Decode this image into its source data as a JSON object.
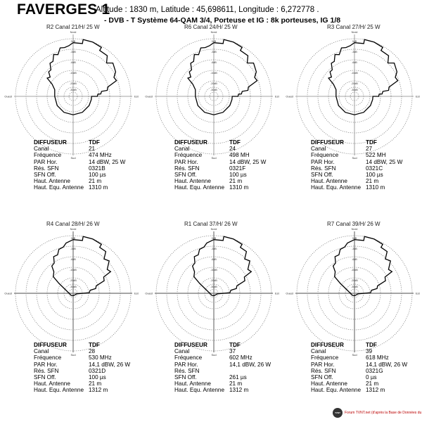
{
  "header": {
    "title": "FAVERGES 1",
    "location": "Altitude : 1830 m,  Latitude : 45,698611,  Longitude : 6,272778 .",
    "system": "- DVB - T    Système 64-QAM 3/4,  Porteuse et IG : 8k porteuses, IG 1/8"
  },
  "labels": {
    "diffuseur": "DIFFUSEUR",
    "canal": "Canal",
    "frequence": "Fréquence",
    "par": "PAR Hor.",
    "res": "Rés. SFN",
    "sfn": "SFN Off.",
    "haut": "Haut. Antenne",
    "hautequ": "Haut. Equ. Antenne"
  },
  "chart_data": [
    {
      "type": "polar",
      "title": "R2   Canal 21/H/ 25 W",
      "directions": [
        "Nord",
        "Est",
        "Sud",
        "Ouest"
      ],
      "rings": [
        "0dB",
        "-3dB",
        "-6dB",
        "-10dB",
        "-20dB",
        "-30dB"
      ],
      "pattern": "A",
      "info": {
        "diffuseur": "TDF",
        "canal": "21",
        "frequence": "474 MHz",
        "par": "14 dBW, 25 W",
        "res": "0321B",
        "sfn": "100 µs",
        "haut": "21 m",
        "hautequ": "1310 m"
      }
    },
    {
      "type": "polar",
      "title": "R6   Canal 24/H/ 25 W",
      "directions": [
        "Nord",
        "Est",
        "Sud",
        "Ouest"
      ],
      "rings": [
        "0dB",
        "-3dB",
        "-6dB",
        "-10dB",
        "-20dB",
        "-30dB"
      ],
      "pattern": "A",
      "info": {
        "diffuseur": "TDF",
        "canal": "24",
        "frequence": "498 MH",
        "par": "14 dBW, 25 W",
        "res": "0321F",
        "sfn": "100 µs",
        "haut": "21 m",
        "hautequ": "1310 m"
      }
    },
    {
      "type": "polar",
      "title": "R3   Canal 27/H/ 25 W",
      "directions": [
        "Nord",
        "Est",
        "Sud",
        "Ouest"
      ],
      "rings": [
        "0dB",
        "-3dB",
        "-6dB",
        "-10dB",
        "-20dB",
        "-30dB"
      ],
      "pattern": "A",
      "info": {
        "diffuseur": "TDF",
        "canal": "27",
        "frequence": "522 MH",
        "par": "14 dBW, 25 W",
        "res": "0321C",
        "sfn": "100 µs",
        "haut": "21 m",
        "hautequ": "1310 m"
      }
    },
    {
      "type": "polar",
      "title": "R4   Canal 28/H/ 26 W",
      "directions": [
        "Nord",
        "Est",
        "Sud",
        "Ouest"
      ],
      "rings": [
        "0dB",
        "-3dB",
        "-6dB",
        "-10dB",
        "-20dB",
        "-30dB"
      ],
      "pattern": "B",
      "info": {
        "diffuseur": "TDF",
        "canal": "28",
        "frequence": "530 MHz",
        "par": "14,1 dBW, 26 W",
        "res": "0321D",
        "sfn": "100 µs",
        "haut": "21 m",
        "hautequ": "1312 m"
      }
    },
    {
      "type": "polar",
      "title": "R1   Canal 37/H/ 26 W",
      "directions": [
        "Nord",
        "Est",
        "Sud",
        "Ouest"
      ],
      "rings": [
        "0dB",
        "-3dB",
        "-6dB",
        "-10dB",
        "-20dB",
        "-30dB"
      ],
      "pattern": "B",
      "info": {
        "diffuseur": "TDF",
        "canal": "37",
        "frequence": "602 MHz",
        "par": "14,1 dBW, 26 W",
        "res": "",
        "sfn": "261 µs",
        "haut": "21 m",
        "hautequ": "1312 m"
      }
    },
    {
      "type": "polar",
      "title": "R7   Canal 39/H/ 26 W",
      "directions": [
        "Nord",
        "Est",
        "Sud",
        "Ouest"
      ],
      "rings": [
        "0dB",
        "-3dB",
        "-6dB",
        "-10dB",
        "-20dB",
        "-30dB"
      ],
      "pattern": "B",
      "info": {
        "diffuseur": "TDF",
        "canal": "39",
        "frequence": "618 MHz",
        "par": "14,1 dBW, 26 W",
        "res": "0321G",
        "sfn": "0 µs",
        "haut": "21 m",
        "hautequ": "1312 m"
      }
    }
  ],
  "patterns": {
    "A": [
      [
        0,
        0.93
      ],
      [
        10,
        0.93
      ],
      [
        10,
        1.0
      ],
      [
        20,
        1.0
      ],
      [
        30,
        0.98
      ],
      [
        30,
        0.92
      ],
      [
        40,
        0.92
      ],
      [
        45,
        0.82
      ],
      [
        50,
        0.9
      ],
      [
        60,
        0.85
      ],
      [
        65,
        0.78
      ],
      [
        70,
        0.8
      ],
      [
        75,
        0.62
      ],
      [
        80,
        0.6
      ],
      [
        80,
        0.5
      ],
      [
        85,
        0.48
      ],
      [
        85,
        0.43
      ],
      [
        90,
        0.42
      ],
      [
        90,
        0.32
      ],
      [
        100,
        0.32
      ],
      [
        120,
        0.32
      ],
      [
        150,
        0.32
      ],
      [
        180,
        0.32
      ],
      [
        210,
        0.32
      ],
      [
        240,
        0.32
      ],
      [
        270,
        0.32
      ],
      [
        290,
        0.34
      ],
      [
        300,
        0.42
      ],
      [
        305,
        0.55
      ],
      [
        310,
        0.52
      ],
      [
        315,
        0.6
      ],
      [
        320,
        0.6
      ],
      [
        325,
        0.7
      ],
      [
        330,
        0.7
      ],
      [
        335,
        0.8
      ],
      [
        340,
        0.77
      ],
      [
        345,
        0.87
      ],
      [
        350,
        0.86
      ],
      [
        355,
        0.88
      ],
      [
        360,
        0.93
      ]
    ],
    "B": [
      [
        0,
        0.93
      ],
      [
        10,
        0.93
      ],
      [
        10,
        1.0
      ],
      [
        20,
        1.0
      ],
      [
        30,
        0.98
      ],
      [
        30,
        0.92
      ],
      [
        38,
        0.92
      ],
      [
        42,
        0.8
      ],
      [
        48,
        0.84
      ],
      [
        55,
        0.72
      ],
      [
        60,
        0.75
      ],
      [
        62,
        0.6
      ],
      [
        68,
        0.58
      ],
      [
        72,
        0.42
      ],
      [
        78,
        0.4
      ],
      [
        80,
        0.3
      ],
      [
        88,
        0.28
      ],
      [
        100,
        0.06
      ],
      [
        150,
        0.04
      ],
      [
        180,
        0.04
      ],
      [
        220,
        0.05
      ],
      [
        260,
        0.06
      ],
      [
        290,
        0.12
      ],
      [
        305,
        0.3
      ],
      [
        310,
        0.45
      ],
      [
        318,
        0.5
      ],
      [
        322,
        0.6
      ],
      [
        328,
        0.62
      ],
      [
        332,
        0.72
      ],
      [
        338,
        0.72
      ],
      [
        342,
        0.8
      ],
      [
        348,
        0.82
      ],
      [
        352,
        0.88
      ],
      [
        360,
        0.93
      ]
    ]
  },
  "footer": {
    "logo": "TVNT",
    "text": "Forum TVNT.net (d'après la Base de Données du CSA)"
  }
}
